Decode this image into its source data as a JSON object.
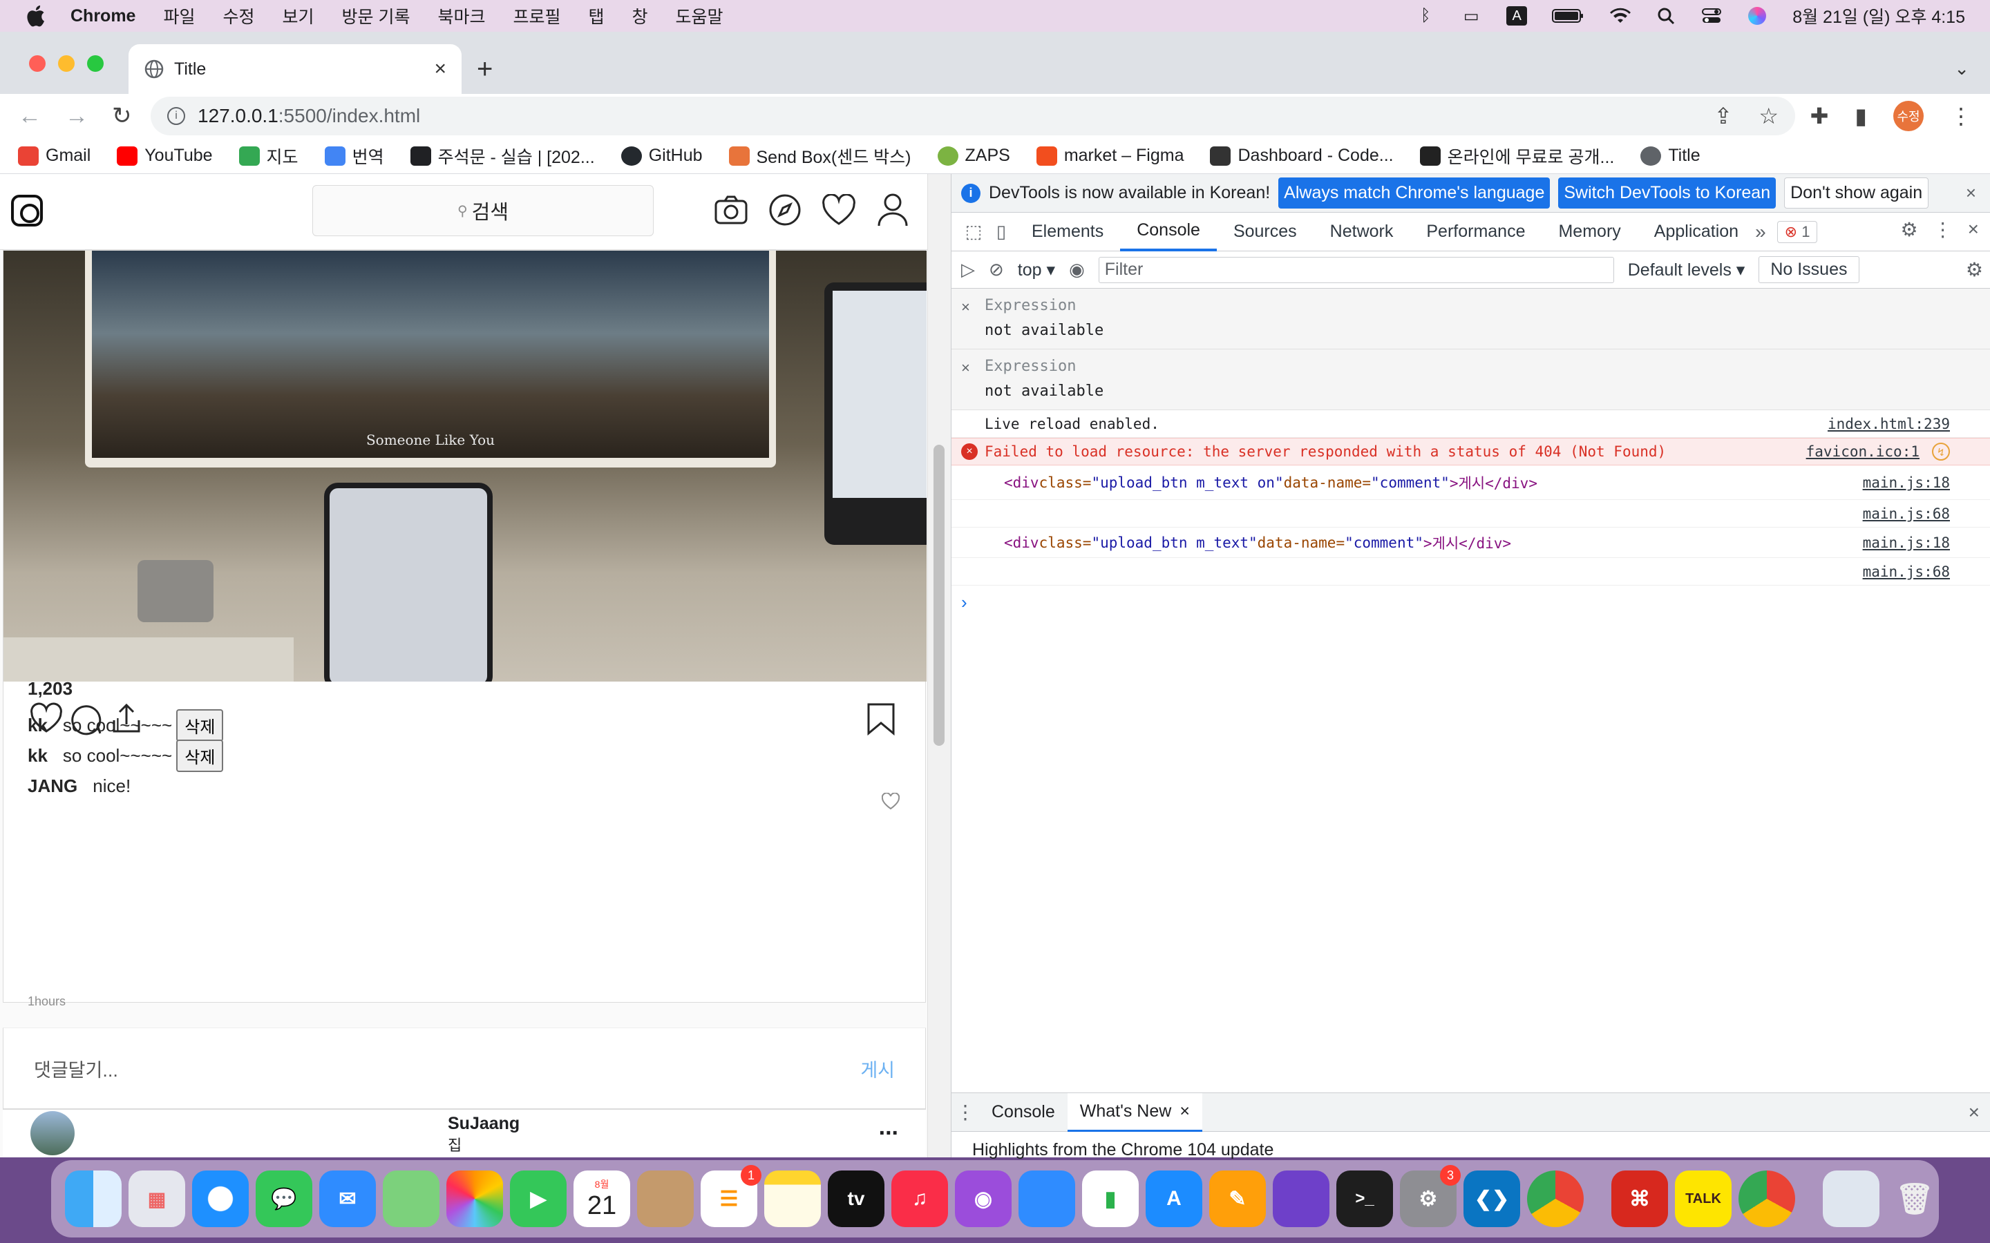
{
  "menubar": {
    "app": "Chrome",
    "items": [
      "파일",
      "수정",
      "보기",
      "방문 기록",
      "북마크",
      "프로필",
      "탭",
      "창",
      "도움말"
    ],
    "datetime": "8월 21일 (일) 오후 4:15",
    "input_source": "A"
  },
  "browser": {
    "tab_title": "Title",
    "url_host": "127.0.0.1",
    "url_path": ":5500/index.html",
    "profile_initials": "수정",
    "bookmarks": [
      {
        "label": "Gmail",
        "color": "#ea4335"
      },
      {
        "label": "YouTube",
        "color": "#ff0000"
      },
      {
        "label": "지도",
        "color": "#34a853"
      },
      {
        "label": "번역",
        "color": "#4285f4"
      },
      {
        "label": "주석문 - 실습 | [202...",
        "color": "#202124"
      },
      {
        "label": "GitHub",
        "color": "#24292e"
      },
      {
        "label": "Send Box(센드 박스)",
        "color": "#e8743b"
      },
      {
        "label": "ZAPS",
        "color": "#7cb342"
      },
      {
        "label": "market – Figma",
        "color": "#f24e1e"
      },
      {
        "label": "Dashboard - Code...",
        "color": "#333333"
      },
      {
        "label": "온라인에 무료로 공개...",
        "color": "#222222"
      },
      {
        "label": "Title",
        "color": "#5f6368"
      }
    ]
  },
  "page": {
    "search_placeholder": "검색",
    "photo_caption": "Someone Like You",
    "likes": "1,203",
    "comments": [
      {
        "user": "kk",
        "text": "so cool~~~~~",
        "delete_label": "삭제"
      },
      {
        "user": "kk",
        "text": "so cool~~~~~",
        "delete_label": "삭제"
      },
      {
        "user": "JANG",
        "text": "nice!",
        "delete_label": ""
      }
    ],
    "time_ago": "1hours",
    "comment_placeholder": "댓글달기...",
    "post_button": "게시",
    "next_post": {
      "username": "SuJaang",
      "subtitle": "집",
      "more": "..."
    }
  },
  "devtools": {
    "infobar": {
      "message": "DevTools is now available in Korean!",
      "btn_match": "Always match Chrome's language",
      "btn_switch": "Switch DevTools to Korean",
      "btn_dismiss": "Don't show again"
    },
    "tabs": [
      "Elements",
      "Console",
      "Sources",
      "Network",
      "Performance",
      "Memory",
      "Application"
    ],
    "active_tab": "Console",
    "error_count": "1",
    "context": "top",
    "filter_placeholder": "Filter",
    "levels": "Default levels",
    "issues": "No Issues",
    "expressions": [
      {
        "label": "Expression",
        "value": "not available"
      },
      {
        "label": "Expression",
        "value": "not available"
      }
    ],
    "logs": {
      "live_reload": {
        "text": "Live reload enabled.",
        "src": "index.html:239"
      },
      "error": {
        "text": "Failed to load resource: the server responded with a status of 404 (Not Found)",
        "src": "favicon.ico:1"
      },
      "html1": {
        "tag_open": "<div",
        "class_attr": " class=",
        "class_val": "\"upload_btn m_text on\"",
        "dn_attr": " data-name=",
        "dn_val": "\"comment\"",
        "inner": ">게시</div>",
        "src": "main.js:18"
      },
      "blank1": {
        "src": "main.js:68"
      },
      "html2": {
        "tag_open": "<div",
        "class_attr": " class=",
        "class_val": "\"upload_btn m_text\"",
        "dn_attr": " data-name=",
        "dn_val": "\"comment\"",
        "inner": ">게시</div>",
        "src": "main.js:18"
      },
      "blank2": {
        "src": "main.js:68"
      }
    },
    "drawer": {
      "tabs": [
        "Console",
        "What's New"
      ],
      "active": "What's New",
      "body": "Highlights from the Chrome 104 update"
    }
  },
  "dock": {
    "calendar_month": "8월",
    "calendar_day": "21",
    "reminders_badge": "1",
    "settings_badge": "3",
    "kakao_label": "TALK",
    "appletv_label": "tv"
  }
}
